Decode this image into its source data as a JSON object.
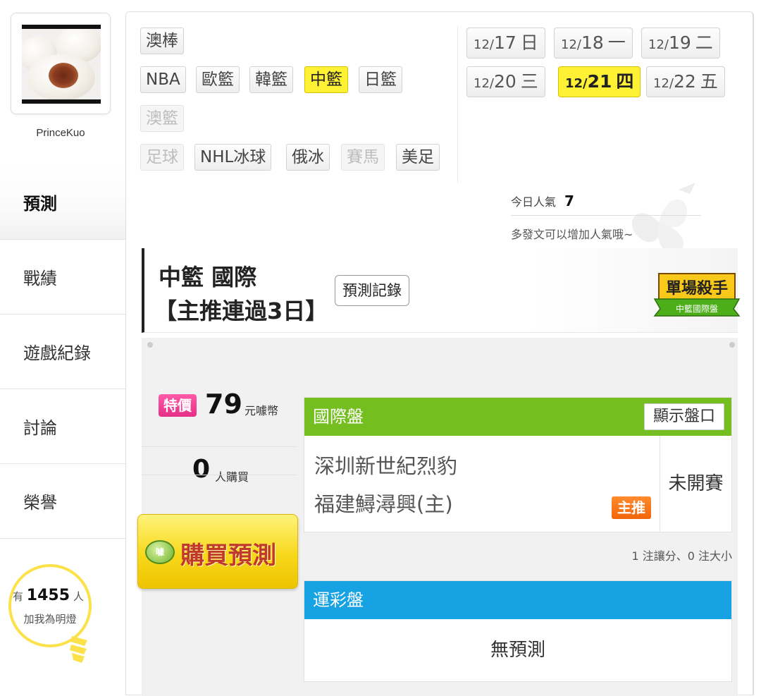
{
  "user": {
    "name": "PrinceKuo",
    "avatar": "steamed-bun-photo"
  },
  "nav": [
    {
      "label": "預測",
      "active": true
    },
    {
      "label": "戰績",
      "active": false
    },
    {
      "label": "遊戲紀錄",
      "active": false
    },
    {
      "label": "討論",
      "active": false
    },
    {
      "label": "榮譽",
      "active": false
    }
  ],
  "fans": {
    "prefix": "有",
    "count": "1455",
    "suffix": "人",
    "caption": "加我為明燈"
  },
  "sports": [
    {
      "label": "澳棒",
      "state": "normal"
    },
    {
      "label": "NBA",
      "state": "normal"
    },
    {
      "label": "歐籃",
      "state": "normal"
    },
    {
      "label": "韓籃",
      "state": "normal"
    },
    {
      "label": "中籃",
      "state": "active"
    },
    {
      "label": "日籃",
      "state": "normal"
    },
    {
      "label": "澳籃",
      "state": "disabled"
    },
    {
      "label": "足球",
      "state": "disabled"
    },
    {
      "label": "NHL冰球",
      "state": "normal"
    },
    {
      "label": "俄冰",
      "state": "normal"
    },
    {
      "label": "賽馬",
      "state": "disabled"
    },
    {
      "label": "美足",
      "state": "normal"
    }
  ],
  "dates": [
    {
      "month": "12/",
      "day": "17",
      "weekday": "日",
      "active": false
    },
    {
      "month": "12/",
      "day": "18",
      "weekday": "一",
      "active": false
    },
    {
      "month": "12/",
      "day": "19",
      "weekday": "二",
      "active": false
    },
    {
      "month": "12/",
      "day": "20",
      "weekday": "三",
      "active": false
    },
    {
      "month": "12/",
      "day": "21",
      "weekday": "四",
      "active": true
    },
    {
      "month": "12/",
      "day": "22",
      "weekday": "五",
      "active": false
    }
  ],
  "popularity": {
    "label": "今日人氣",
    "value": "7",
    "hint": "多發文可以增加人氣哦~"
  },
  "header": {
    "title": "中籃 國際",
    "subtitle": "【主推連過3日】",
    "record_button": "預測記錄",
    "badge_title": "單場殺手",
    "badge_sub": "中籃國際盤"
  },
  "price": {
    "tag": "特價",
    "value": "79",
    "unit": "元噱幣"
  },
  "buyers": {
    "count": "0",
    "unit": "人購買"
  },
  "buy_button": {
    "label": "購買預測",
    "coin": "噱"
  },
  "intl": {
    "title": "國際盤",
    "show_button": "顯示盤口",
    "team_away": "深圳新世紀烈豹",
    "team_home": "福建鱘潯興(主)",
    "main_tag": "主推",
    "status": "未開賽",
    "note": "1 注讓分、0 注大小"
  },
  "lottery": {
    "title": "運彩盤",
    "empty": "無預測"
  },
  "colors": {
    "accent_yellow": "#fff133",
    "green": "#74bf1f",
    "blue": "#16a2e3",
    "pink": "#e52f87",
    "orange": "#f2650a"
  }
}
